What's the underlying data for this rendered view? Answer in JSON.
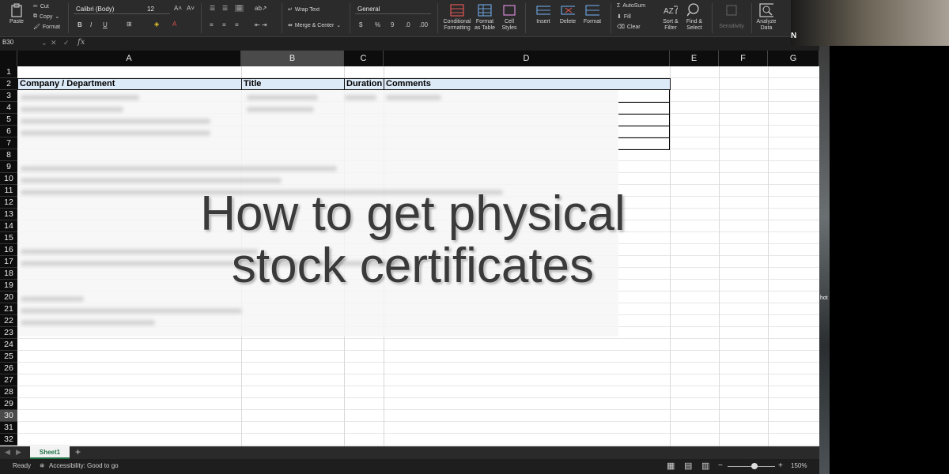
{
  "ribbon": {
    "clipboard": {
      "paste": "Paste",
      "cut": "Cut",
      "copy": "Copy",
      "format": "Format"
    },
    "font": {
      "name": "Calibri (Body)",
      "size": "12",
      "bold": "B",
      "italic": "I",
      "underline": "U"
    },
    "alignment": {
      "wrap_text": "Wrap Text",
      "merge_center": "Merge & Center"
    },
    "number": {
      "format": "General",
      "currency": "$",
      "percent": "%",
      "comma": "9"
    },
    "styles": {
      "conditional_1": "Conditional",
      "conditional_2": "Formatting",
      "format_table_1": "Format",
      "format_table_2": "as Table",
      "cell_styles_1": "Cell",
      "cell_styles_2": "Styles"
    },
    "cells": {
      "insert": "Insert",
      "delete": "Delete",
      "format": "Format"
    },
    "editing": {
      "autosum": "AutoSum",
      "fill": "Fill",
      "clear": "Clear",
      "sort_1": "Sort &",
      "sort_2": "Filter",
      "find_1": "Find &",
      "find_2": "Select"
    },
    "sensitivity": "Sensitivity",
    "analyze_1": "Analyze",
    "analyze_2": "Data"
  },
  "formula_bar": {
    "name_box": "B30",
    "fx": "fx"
  },
  "columns": [
    "A",
    "B",
    "C",
    "D",
    "E",
    "F",
    "G"
  ],
  "rows": [
    "1",
    "2",
    "3",
    "4",
    "5",
    "6",
    "7",
    "8",
    "9",
    "10",
    "11",
    "12",
    "13",
    "14",
    "15",
    "16",
    "17",
    "18",
    "19",
    "20",
    "21",
    "22",
    "23",
    "24",
    "25",
    "26",
    "27",
    "28",
    "29",
    "30",
    "31",
    "32"
  ],
  "table_headers": {
    "company": "Company / Department",
    "title": "Title",
    "duration": "Duration",
    "comments": "Comments"
  },
  "overlay_title": {
    "line1": "How to get physical",
    "line2": "stock certificates"
  },
  "sheet": {
    "tab": "Sheet1",
    "add": "+"
  },
  "status": {
    "ready": "Ready",
    "accessibility": "Accessibility: Good to go",
    "zoom": "150%"
  },
  "side_text": {
    "n": "N",
    "hot": "hot"
  },
  "colors": {
    "header_fill": "#dce9f7",
    "ribbon_bg": "#2b2b2b",
    "accent": "#217346"
  }
}
